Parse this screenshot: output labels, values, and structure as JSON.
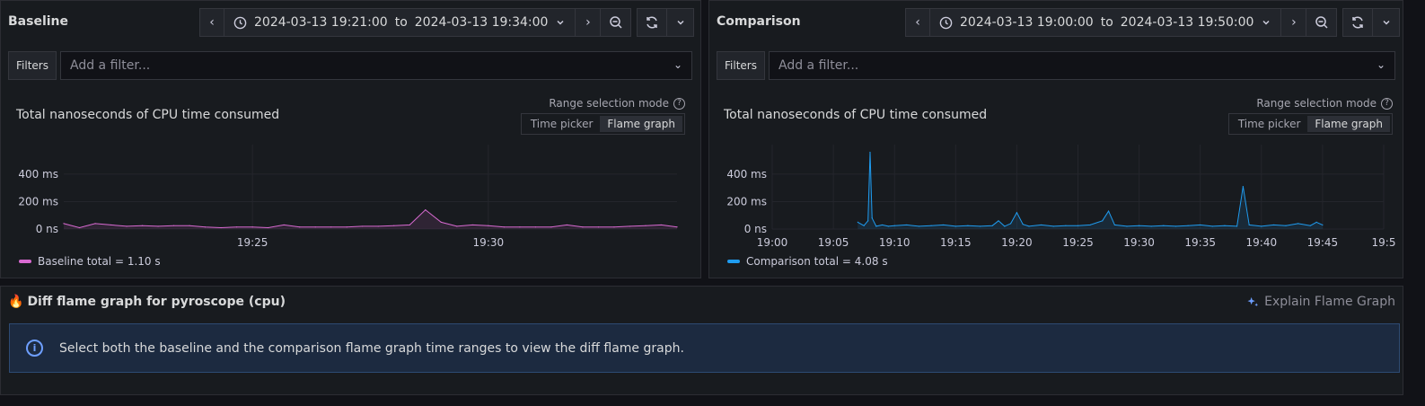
{
  "baseline": {
    "title": "Baseline",
    "time_range": {
      "from": "2024-03-13 19:21:00",
      "to_word": "to",
      "to": "2024-03-13 19:34:00"
    },
    "filters": {
      "label": "Filters",
      "placeholder": "Add a filter..."
    },
    "range_selection": {
      "label": "Range selection mode",
      "options": [
        "Time picker",
        "Flame graph"
      ],
      "active": "Flame graph"
    },
    "chart_title": "Total nanoseconds of CPU time consumed",
    "legend": "Baseline total = 1.10 s",
    "color": "#d86ad1"
  },
  "comparison": {
    "title": "Comparison",
    "time_range": {
      "from": "2024-03-13 19:00:00",
      "to_word": "to",
      "to": "2024-03-13 19:50:00"
    },
    "filters": {
      "label": "Filters",
      "placeholder": "Add a filter..."
    },
    "range_selection": {
      "label": "Range selection mode",
      "options": [
        "Time picker",
        "Flame graph"
      ],
      "active": "Flame graph"
    },
    "chart_title": "Total nanoseconds of CPU time consumed",
    "legend": "Comparison total = 4.08 s",
    "color": "#1f9cf0"
  },
  "diff": {
    "title": "Diff flame graph for pyroscope (cpu)",
    "explain": "Explain Flame Graph",
    "message": "Select both the baseline and the comparison flame graph time ranges to view the diff flame graph."
  },
  "chart_data": [
    {
      "type": "line",
      "x_unit": "time",
      "y_ticks": [
        "0 ns",
        "200 ms",
        "400 ms"
      ],
      "ylim": [
        0,
        550
      ],
      "x_ticks": [
        "19:25",
        "19:30"
      ],
      "xlim": [
        "19:21:00",
        "19:34:00"
      ],
      "series": [
        {
          "name": "Baseline total",
          "x": [
            "19:21:00",
            "19:21:20",
            "19:21:40",
            "19:22:00",
            "19:22:20",
            "19:22:40",
            "19:23:00",
            "19:23:20",
            "19:23:40",
            "19:24:00",
            "19:24:20",
            "19:24:40",
            "19:25:00",
            "19:25:20",
            "19:25:40",
            "19:26:00",
            "19:26:20",
            "19:26:40",
            "19:27:00",
            "19:27:20",
            "19:27:40",
            "19:28:00",
            "19:28:20",
            "19:28:40",
            "19:29:00",
            "19:29:20",
            "19:29:40",
            "19:30:00",
            "19:30:20",
            "19:30:40",
            "19:31:00",
            "19:31:20",
            "19:31:40",
            "19:32:00",
            "19:32:20",
            "19:32:40",
            "19:33:00",
            "19:33:20",
            "19:33:40",
            "19:34:00"
          ],
          "values": [
            40,
            10,
            40,
            30,
            20,
            25,
            20,
            25,
            25,
            15,
            10,
            15,
            15,
            10,
            30,
            15,
            15,
            15,
            15,
            20,
            20,
            25,
            30,
            140,
            50,
            20,
            30,
            25,
            15,
            15,
            15,
            15,
            30,
            15,
            15,
            15,
            20,
            25,
            30,
            15
          ]
        }
      ],
      "grid": true
    },
    {
      "type": "line",
      "x_unit": "time",
      "y_ticks": [
        "0 ns",
        "200 ms",
        "400 ms"
      ],
      "ylim": [
        0,
        550
      ],
      "x_ticks": [
        "19:00",
        "19:05",
        "19:10",
        "19:15",
        "19:20",
        "19:25",
        "19:30",
        "19:35",
        "19:40",
        "19:45",
        "19:5"
      ],
      "xlim": [
        "19:00:00",
        "19:50:00"
      ],
      "series": [
        {
          "name": "Comparison total",
          "x": [
            "19:07:00",
            "19:07:30",
            "19:07:50",
            "19:08:00",
            "19:08:10",
            "19:08:30",
            "19:09:00",
            "19:09:30",
            "19:10:00",
            "19:11:00",
            "19:12:00",
            "19:13:00",
            "19:14:00",
            "19:15:00",
            "19:16:00",
            "19:17:00",
            "19:18:00",
            "19:18:30",
            "19:19:00",
            "19:19:30",
            "19:20:00",
            "19:20:30",
            "19:21:00",
            "19:22:00",
            "19:23:00",
            "19:24:00",
            "19:25:00",
            "19:26:00",
            "19:27:00",
            "19:27:30",
            "19:28:00",
            "19:29:00",
            "19:30:00",
            "19:31:00",
            "19:32:00",
            "19:33:00",
            "19:34:00",
            "19:35:00",
            "19:36:00",
            "19:37:00",
            "19:38:00",
            "19:38:30",
            "19:39:00",
            "19:40:00",
            "19:41:00",
            "19:42:00",
            "19:43:00",
            "19:44:00",
            "19:44:30",
            "19:45:00"
          ],
          "values": [
            50,
            25,
            60,
            560,
            80,
            20,
            30,
            20,
            25,
            30,
            20,
            25,
            30,
            20,
            25,
            20,
            25,
            60,
            20,
            40,
            120,
            35,
            20,
            30,
            20,
            25,
            25,
            30,
            60,
            130,
            30,
            20,
            25,
            20,
            25,
            20,
            25,
            30,
            20,
            25,
            20,
            310,
            30,
            20,
            30,
            25,
            40,
            25,
            50,
            30
          ]
        }
      ],
      "grid": true
    }
  ]
}
